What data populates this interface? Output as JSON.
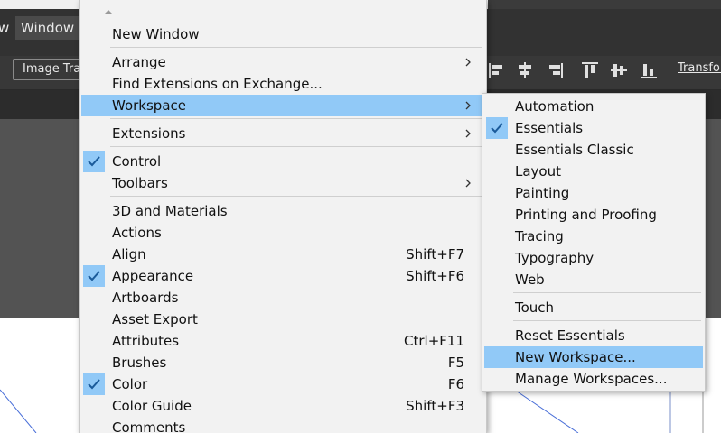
{
  "menubar": {
    "partial_item": "w",
    "window_label": "Window"
  },
  "toolbar": {
    "image_trace_label": "Image Trace",
    "transform_label": "Transform",
    "align_icons": [
      "align-left-icon",
      "align-horizontal-center-icon",
      "align-right-icon",
      "align-top-icon",
      "align-vertical-center-icon",
      "align-bottom-icon"
    ]
  },
  "window_menu": {
    "items": [
      {
        "label": "New Window"
      },
      {
        "label": "Arrange",
        "submenu": true
      },
      {
        "label": "Find Extensions on Exchange..."
      },
      {
        "label": "Workspace",
        "submenu": true,
        "highlighted": true
      },
      {
        "label": "Extensions",
        "submenu": true
      },
      {
        "label": "Control",
        "checked": true
      },
      {
        "label": "Toolbars",
        "submenu": true
      },
      {
        "label": "3D and Materials"
      },
      {
        "label": "Actions"
      },
      {
        "label": "Align",
        "shortcut": "Shift+F7"
      },
      {
        "label": "Appearance",
        "shortcut": "Shift+F6",
        "checked": true
      },
      {
        "label": "Artboards"
      },
      {
        "label": "Asset Export"
      },
      {
        "label": "Attributes",
        "shortcut": "Ctrl+F11"
      },
      {
        "label": "Brushes",
        "shortcut": "F5"
      },
      {
        "label": "Color",
        "shortcut": "F6",
        "checked": true
      },
      {
        "label": "Color Guide",
        "shortcut": "Shift+F3"
      },
      {
        "label": "Comments"
      }
    ]
  },
  "workspace_submenu": {
    "items": [
      {
        "label": "Automation"
      },
      {
        "label": "Essentials",
        "checked": true
      },
      {
        "label": "Essentials Classic"
      },
      {
        "label": "Layout"
      },
      {
        "label": "Painting"
      },
      {
        "label": "Printing and Proofing"
      },
      {
        "label": "Tracing"
      },
      {
        "label": "Typography"
      },
      {
        "label": "Web"
      },
      {
        "label": "Touch"
      },
      {
        "label": "Reset Essentials"
      },
      {
        "label": "New Workspace...",
        "highlighted": true
      },
      {
        "label": "Manage Workspaces..."
      }
    ]
  },
  "colors": {
    "highlight": "#91c9f7",
    "menu_bg": "#f2f2f2",
    "app_dark": "#323232"
  }
}
